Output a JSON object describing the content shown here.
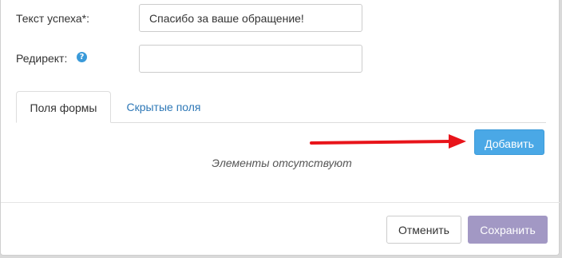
{
  "form": {
    "success_text_label": "Текст успеха*:",
    "success_text_value": "Спасибо за ваше обращение!",
    "redirect_label": "Редирект:",
    "redirect_value": "",
    "help_icon": "question-circle-icon"
  },
  "tabs": [
    {
      "label": "Поля формы",
      "active": true
    },
    {
      "label": "Скрытые поля",
      "active": false
    }
  ],
  "fields_panel": {
    "add_button_label": "Добавить",
    "empty_text": "Элементы отсутствуют"
  },
  "footer": {
    "cancel_label": "Отменить",
    "save_label": "Сохранить"
  },
  "colors": {
    "add_button": "#4aa8e6",
    "save_button": "#a298c4",
    "tab_link": "#2e78b7",
    "annotation_arrow": "#e8141a"
  }
}
